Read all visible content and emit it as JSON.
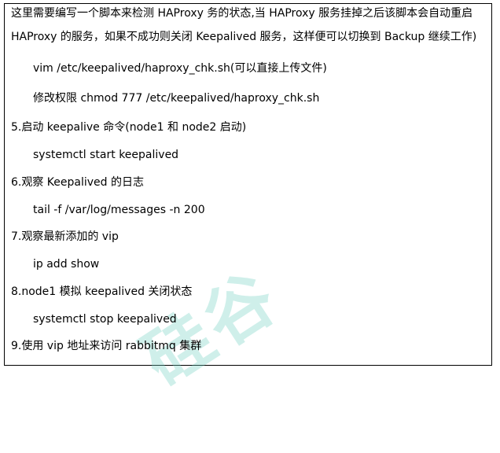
{
  "watermark": {
    "text": "硅谷",
    "color": "#6fd0c2"
  },
  "intro": {
    "line1": "这里需要编写一个脚本来检测 HAProxy 务的状态,当 HAProxy 服务挂掉之后该脚本会自动重启",
    "line2": "HAProxy 的服务，如果不成功则关闭 Keepalived 服务，这样便可以切换到 Backup  继续工作)"
  },
  "commands": {
    "vim": "vim /etc/keepalived/haproxy_chk.sh(可以直接上传文件)",
    "chmod": "修改权限 chmod 777 /etc/keepalived/haproxy_chk.sh",
    "start": "systemctl start keepalived",
    "tail": "tail -f /var/log/messages -n 200",
    "ip": "ip add show",
    "stop": "systemctl stop keepalived"
  },
  "steps": {
    "s5": "5.启动 keepalive 命令(node1 和 node2 启动)",
    "s6": "6.观察 Keepalived 的日志",
    "s7": "7.观察最新添加的 vip",
    "s8": "8.node1 模拟 keepalived 关闭状态",
    "s9": "9.使用 vip 地址来访问 rabbitmq 集群"
  }
}
